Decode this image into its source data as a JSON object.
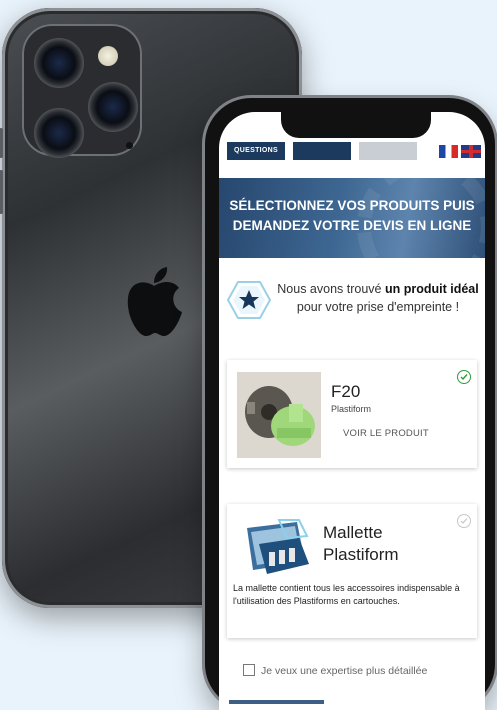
{
  "nav": {
    "questions": "QUESTIONS",
    "second": "",
    "third": ""
  },
  "banner": {
    "line1": "SÉLECTIONNEZ VOS PRODUITS PUIS",
    "line2": "DEMANDEZ VOTRE DEVIS EN LIGNE"
  },
  "found": {
    "before": "Nous avons trouvé ",
    "bold": "un produit idéal",
    "after": "pour votre prise d'empreinte !"
  },
  "product": {
    "title": "F20",
    "subtitle": "Plastiform",
    "link": "VOIR LE PRODUIT"
  },
  "kit": {
    "title": "Mallette Plastiform",
    "description": "La mallette contient tous les accessoires indispensable à l'utilisation des Plastiforms en cartouches."
  },
  "expertise": {
    "label": "Je veux une expertise plus détaillée"
  },
  "colors": {
    "nav": "#1c3a5e",
    "banner": "#3d6792",
    "check_on": "#2e9b3f"
  }
}
